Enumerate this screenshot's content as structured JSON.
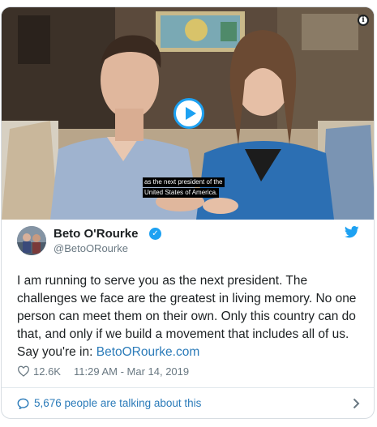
{
  "video": {
    "caption_line1": "as the next president of the",
    "caption_line2": "United States of America.",
    "info_icon": "info-icon",
    "play_icon": "play-icon"
  },
  "author": {
    "name": "Beto O'Rourke",
    "handle": "@BetoORourke",
    "verified_icon": "verified-badge-icon",
    "platform_icon": "twitter-bird-icon"
  },
  "tweet": {
    "text": "I am running to serve you as the next president. The challenges we face are the greatest in living memory. No one person can meet them on their own. Only this country can do that, and only if we build a movement that includes all of us. Say you're in: ",
    "link_text": "BetoORourke.com"
  },
  "meta": {
    "likes": "12.6K",
    "timestamp": "11:29 AM - Mar 14, 2019",
    "heart_icon": "heart-icon"
  },
  "conversation": {
    "label": "5,676 people are talking about this",
    "bubble_icon": "speech-bubble-icon",
    "chevron_icon": "chevron-right-icon"
  },
  "colors": {
    "accent": "#1da1f2",
    "link": "#2b7bb9",
    "muted": "#697882",
    "text": "#1c2022"
  }
}
